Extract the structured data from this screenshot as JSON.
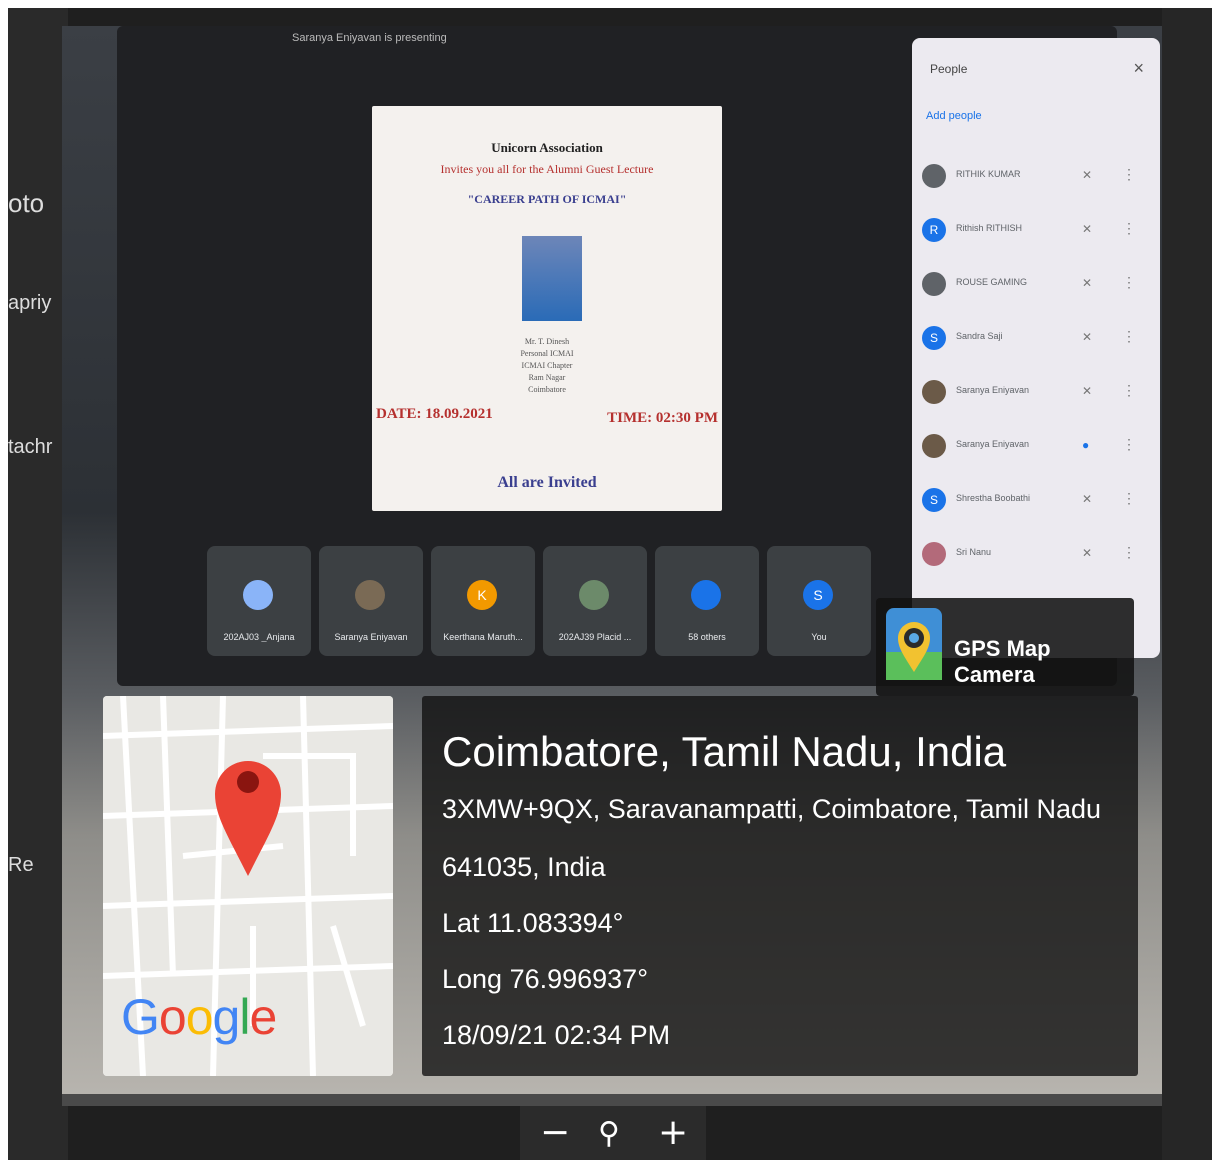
{
  "background_peek": {
    "text1": "oto",
    "text2": "apriy",
    "text3": "tachr",
    "text4": "Re"
  },
  "meet_screen": {
    "presenting_banner": "Saranya Eniyavan is presenting",
    "slide": {
      "association": "Unicorn Association",
      "invites": "Invites you all for the Alumni Guest Lecture",
      "topic": "\"CAREER PATH OF ICMAI\"",
      "speaker_lines": [
        "Mr. T. Dinesh",
        "Personal ICMAI",
        "ICMAI Chapter",
        "Ram Nagar",
        "Coimbatore"
      ],
      "date": "DATE: 18.09.2021",
      "time": "TIME: 02:30 PM",
      "closing": "All are Invited"
    },
    "tiles": [
      {
        "initial": "",
        "name": "202AJ03 _Anjana",
        "color": "#8ab4f8"
      },
      {
        "initial": "",
        "name": "Saranya Eniyavan",
        "color": "#7a6a55"
      },
      {
        "initial": "K",
        "name": "Keerthana Maruth...",
        "color": "#f29900"
      },
      {
        "initial": "",
        "name": "202AJ39 Placid ...",
        "color": "#6c8a6a"
      },
      {
        "initial": "",
        "name": "58 others",
        "color": "#1a73e8"
      },
      {
        "initial": "S",
        "name": "You",
        "color": "#1a73e8"
      }
    ],
    "people_panel": {
      "title": "People",
      "close": "×",
      "add_people": "Add people",
      "participants": [
        {
          "initial": "",
          "name": "RITHIK KUMAR"
        },
        {
          "initial": "R",
          "name": "Rithish RITHISH"
        },
        {
          "initial": "",
          "name": "ROUSE GAMING"
        },
        {
          "initial": "S",
          "name": "Sandra Saji"
        },
        {
          "initial": "",
          "name": "Saranya Eniyavan"
        },
        {
          "initial": "",
          "name": "Saranya Eniyavan"
        },
        {
          "initial": "S",
          "name": "Shrestha Boobathi"
        },
        {
          "initial": "",
          "name": "Sri Nanu"
        }
      ]
    }
  },
  "gps_badge": {
    "title": "GPS Map Camera"
  },
  "map_card": {
    "logo_letters": [
      "G",
      "o",
      "o",
      "g",
      "l",
      "e"
    ],
    "logo_colors": [
      "#4285f4",
      "#ea4335",
      "#fbbc05",
      "#4285f4",
      "#34a853",
      "#ea4335"
    ]
  },
  "location": {
    "city": "Coimbatore, Tamil Nadu, India",
    "address_line1": "3XMW+9QX, Saravanampatti, Coimbatore, Tamil Nadu",
    "address_line2": "641035, India",
    "latitude": "Lat 11.083394°",
    "longitude": "Long 76.996937°",
    "datetime": "18/09/21 02:34 PM"
  },
  "zoom_controls": {
    "zoom_out": "−",
    "zoom_icon": "⚲",
    "zoom_in": "+"
  }
}
